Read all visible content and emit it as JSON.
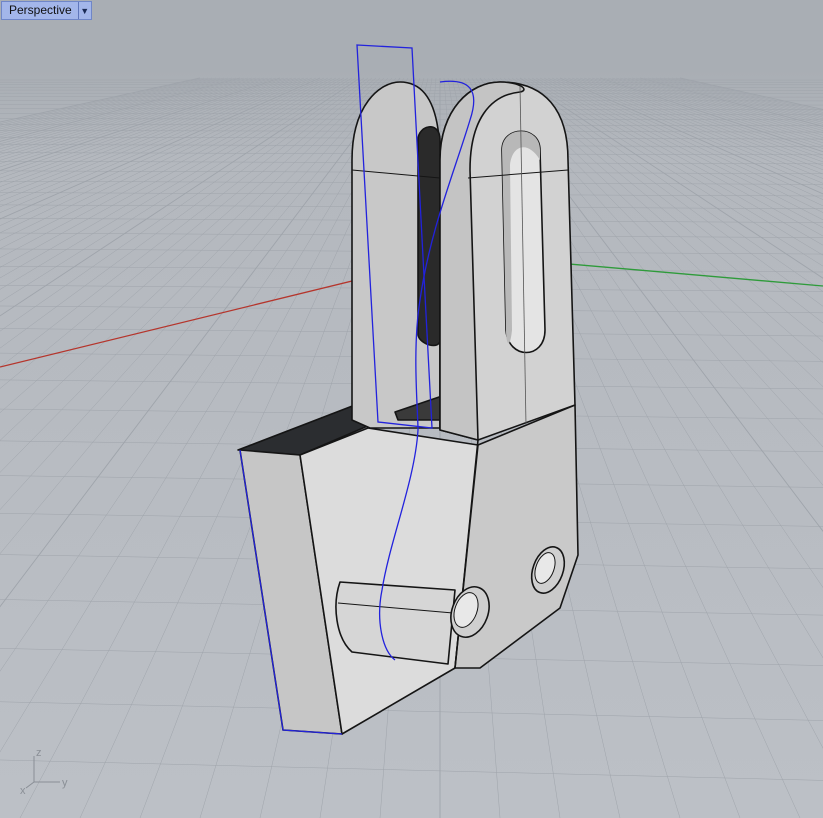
{
  "viewport": {
    "title": "Perspective",
    "menu_icon": "chevron-down-icon"
  },
  "axes": {
    "z_label": "z",
    "y_label": "y",
    "x_label": "x"
  },
  "colors": {
    "background": "#b4b8be",
    "grid": "#9fa4ab",
    "x_axis": "#b5352c",
    "y_axis": "#2e9b3a",
    "selection_curve": "#2222dd",
    "model_face": "#d4d4d4",
    "model_edge": "#111111",
    "tab": "#a3b6ea"
  }
}
